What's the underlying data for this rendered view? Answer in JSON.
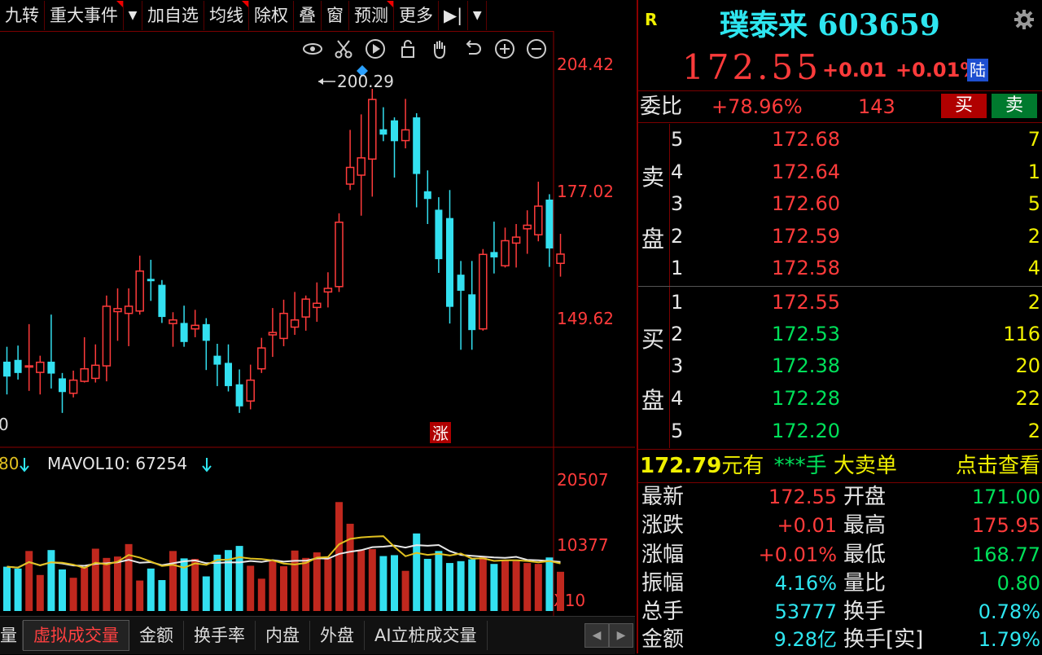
{
  "toolbar": {
    "items": [
      "九转",
      "重大事件",
      "▼",
      "加自选",
      "均线",
      "除权",
      "叠",
      "窗",
      "预测",
      "更多",
      "▶|",
      "▼"
    ]
  },
  "chart_icons": [
    "eye-icon",
    "scissors-icon",
    "play-icon",
    "lock-icon",
    "hand-icon",
    "undo-icon",
    "zoom-in-icon",
    "zoom-out-icon"
  ],
  "price_chart": {
    "axis_labels": [
      "204.42",
      "177.02",
      "149.62"
    ],
    "high_marker": "200.29",
    "left_partial_label": "0",
    "zhang_badge": "涨",
    "ylim": [
      140,
      210
    ]
  },
  "volume_chart": {
    "left_partial_label": "80",
    "mavol_label": "MAVOL10: 67254",
    "axis_labels": [
      "20507",
      "10377",
      "X10"
    ],
    "ylim": [
      0,
      30000
    ]
  },
  "chart_data": [
    {
      "type": "candlestick",
      "series": [
        {
          "o": 154.5,
          "c": 152.0,
          "h": 157.0,
          "l": 149.0
        },
        {
          "o": 154.8,
          "c": 152.6,
          "h": 157.2,
          "l": 151.5
        },
        {
          "o": 153.6,
          "c": 153.8,
          "h": 160.8,
          "l": 149.6
        },
        {
          "o": 152.7,
          "c": 154.4,
          "h": 155.5,
          "l": 149.0
        },
        {
          "o": 154.5,
          "c": 152.5,
          "h": 162.4,
          "l": 150.0
        },
        {
          "o": 151.7,
          "c": 149.4,
          "h": 152.6,
          "l": 145.9
        },
        {
          "o": 149.2,
          "c": 151.4,
          "h": 153.0,
          "l": 148.5
        },
        {
          "o": 151.2,
          "c": 153.3,
          "h": 158.6,
          "l": 151.0
        },
        {
          "o": 151.7,
          "c": 153.9,
          "h": 157.4,
          "l": 151.0
        },
        {
          "o": 153.8,
          "c": 163.8,
          "h": 165.6,
          "l": 151.2
        },
        {
          "o": 162.9,
          "c": 163.4,
          "h": 166.8,
          "l": 158.0
        },
        {
          "o": 162.6,
          "c": 163.8,
          "h": 166.8,
          "l": 157.1
        },
        {
          "o": 163.0,
          "c": 169.7,
          "h": 172.3,
          "l": 162.4
        },
        {
          "o": 168.4,
          "c": 168.0,
          "h": 171.6,
          "l": 164.7
        },
        {
          "o": 167.4,
          "c": 162.0,
          "h": 168.2,
          "l": 161.0
        },
        {
          "o": 160.9,
          "c": 161.5,
          "h": 162.8,
          "l": 157.0
        },
        {
          "o": 161.0,
          "c": 157.8,
          "h": 163.9,
          "l": 157.0
        },
        {
          "o": 160.0,
          "c": 160.6,
          "h": 163.2,
          "l": 158.6
        },
        {
          "o": 160.8,
          "c": 158.0,
          "h": 161.8,
          "l": 153.1
        },
        {
          "o": 155.5,
          "c": 154.0,
          "h": 157.5,
          "l": 150.4
        },
        {
          "o": 154.3,
          "c": 150.4,
          "h": 157.4,
          "l": 149.5
        },
        {
          "o": 150.7,
          "c": 147.0,
          "h": 153.2,
          "l": 145.9
        },
        {
          "o": 147.9,
          "c": 151.4,
          "h": 154.0,
          "l": 146.5
        },
        {
          "o": 153.3,
          "c": 156.8,
          "h": 158.5,
          "l": 152.6
        },
        {
          "o": 159.0,
          "c": 159.4,
          "h": 163.5,
          "l": 155.3
        },
        {
          "o": 158.4,
          "c": 162.6,
          "h": 164.9,
          "l": 157.1
        },
        {
          "o": 160.3,
          "c": 161.5,
          "h": 166.2,
          "l": 159.0
        },
        {
          "o": 162.0,
          "c": 165.0,
          "h": 165.6,
          "l": 159.7
        },
        {
          "o": 163.6,
          "c": 164.3,
          "h": 167.8,
          "l": 161.2
        },
        {
          "o": 166.2,
          "c": 166.8,
          "h": 169.5,
          "l": 163.6
        },
        {
          "o": 167.1,
          "c": 177.9,
          "h": 179.4,
          "l": 166.2
        },
        {
          "o": 184.3,
          "c": 187.1,
          "h": 193.4,
          "l": 183.3
        },
        {
          "o": 185.8,
          "c": 188.7,
          "h": 196.0,
          "l": 179.0
        },
        {
          "o": 188.5,
          "c": 198.5,
          "h": 200.29,
          "l": 182.2
        },
        {
          "o": 193.5,
          "c": 192.6,
          "h": 197.2,
          "l": 191.5
        },
        {
          "o": 195.0,
          "c": 191.5,
          "h": 195.5,
          "l": 185.4
        },
        {
          "o": 191.6,
          "c": 193.4,
          "h": 198.6,
          "l": 190.3
        },
        {
          "o": 195.5,
          "c": 186.0,
          "h": 196.2,
          "l": 180.4
        },
        {
          "o": 183.1,
          "c": 181.8,
          "h": 186.6,
          "l": 177.6
        },
        {
          "o": 180.0,
          "c": 171.7,
          "h": 182.1,
          "l": 169.4
        },
        {
          "o": 178.6,
          "c": 163.7,
          "h": 183.3,
          "l": 160.9
        },
        {
          "o": 169.1,
          "c": 166.4,
          "h": 171.4,
          "l": 156.5
        },
        {
          "o": 165.8,
          "c": 159.8,
          "h": 171.4,
          "l": 156.5
        },
        {
          "o": 160.0,
          "c": 172.5,
          "h": 173.4,
          "l": 159.7
        },
        {
          "o": 172.9,
          "c": 172.0,
          "h": 178.0,
          "l": 169.3
        },
        {
          "o": 170.6,
          "c": 174.8,
          "h": 177.0,
          "l": 170.3
        },
        {
          "o": 174.4,
          "c": 175.4,
          "h": 177.6,
          "l": 170.3
        },
        {
          "o": 176.8,
          "c": 177.4,
          "h": 179.9,
          "l": 172.6
        },
        {
          "o": 175.8,
          "c": 180.6,
          "h": 184.7,
          "l": 174.7
        },
        {
          "o": 181.7,
          "c": 173.5,
          "h": 182.6,
          "l": 170.4
        },
        {
          "o": 171.0,
          "c": 172.55,
          "h": 175.95,
          "l": 168.77
        }
      ]
    },
    {
      "type": "bar",
      "series": [
        {
          "name": "volume",
          "values": [
            9600,
            9200,
            13000,
            7800,
            13200,
            9000,
            7200,
            9400,
            13500,
            11500,
            11800,
            14500,
            6600,
            9200,
            6700,
            13000,
            11400,
            11300,
            7500,
            12200,
            13200,
            14100,
            9800,
            7000,
            10800,
            9700,
            13100,
            11500,
            12700,
            11400,
            23600,
            18900,
            13200,
            13400,
            11900,
            12100,
            8700,
            16800,
            11300,
            13000,
            10400,
            10800,
            11200,
            11700,
            10200,
            11100,
            10800,
            10400,
            10200,
            11600,
            8500
          ]
        }
      ]
    }
  ],
  "stock": {
    "r_label": "R",
    "name_code": "璞泰来 603659",
    "price": "172.55",
    "change": "+0.01",
    "change_pct": "+0.01%",
    "market_badge": "陆",
    "weibi_label": "委比",
    "weibi_pct": "+78.96%",
    "weibi_diff": "143",
    "buy_button": "买",
    "sell_button": "卖"
  },
  "order_book": {
    "sell_side_label_top": "卖",
    "sell_side_label_bottom": "盘",
    "buy_side_label_top": "买",
    "buy_side_label_bottom": "盘",
    "sells": [
      {
        "level": "5",
        "price": "172.68",
        "qty": "7"
      },
      {
        "level": "4",
        "price": "172.64",
        "qty": "1"
      },
      {
        "level": "3",
        "price": "172.60",
        "qty": "5"
      },
      {
        "level": "2",
        "price": "172.59",
        "qty": "2"
      },
      {
        "level": "1",
        "price": "172.58",
        "qty": "4"
      }
    ],
    "buys": [
      {
        "level": "1",
        "price": "172.55",
        "qty": "2"
      },
      {
        "level": "2",
        "price": "172.53",
        "qty": "116"
      },
      {
        "level": "3",
        "price": "172.38",
        "qty": "20"
      },
      {
        "level": "4",
        "price": "172.28",
        "qty": "22"
      },
      {
        "level": "5",
        "price": "172.20",
        "qty": "2"
      }
    ]
  },
  "big_order": {
    "price_text": "172.79",
    "suffix": "元有",
    "stars": "***手",
    "type": "大卖单",
    "link": "点击查看"
  },
  "stats": [
    {
      "l_label": "最新",
      "l_value": "172.55",
      "l_color": "red",
      "r_label": "开盘",
      "r_value": "171.00",
      "r_color": "green"
    },
    {
      "l_label": "涨跌",
      "l_value": "+0.01",
      "l_color": "red",
      "r_label": "最高",
      "r_value": "175.95",
      "r_color": "red"
    },
    {
      "l_label": "涨幅",
      "l_value": "+0.01%",
      "l_color": "red",
      "r_label": "最低",
      "r_value": "168.77",
      "r_color": "green"
    },
    {
      "l_label": "振幅",
      "l_value": "4.16%",
      "l_color": "cyan",
      "r_label": "量比",
      "r_value": "0.80",
      "r_color": "green"
    },
    {
      "l_label": "总手",
      "l_value": "53777",
      "l_color": "cyan",
      "r_label": "换手",
      "r_value": "0.78%",
      "r_color": "cyan"
    },
    {
      "l_label": "金额",
      "l_value": "9.28亿",
      "l_color": "cyan",
      "r_label": "换手[实]",
      "r_value": "1.79%",
      "r_color": "cyan"
    }
  ],
  "tabs": [
    "量",
    "虚拟成交量",
    "金额",
    "换手率",
    "内盘",
    "外盘",
    "AI立桩成交量"
  ],
  "tab_nav": [
    "◀",
    "▶"
  ],
  "colors": {
    "up": "#ff3b3b",
    "down": "#33e0f0",
    "ma_white": "#e8e8e8",
    "ma_yellow": "#e0c020",
    "frame": "#8b0000"
  }
}
